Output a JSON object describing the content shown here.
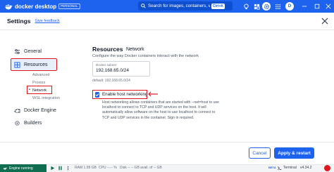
{
  "app": {
    "logo_text": "docker desktop",
    "plan_badge": "PERSONAL",
    "search_placeholder": "Search for images, containers, volu...",
    "search_shortcut": "Ctrl+K",
    "avatar_initial": "D",
    "brand_color": "#1d63ed"
  },
  "header": {
    "title": "Settings",
    "feedback_link": "Give feedback"
  },
  "sidebar": {
    "items": [
      {
        "label": "General",
        "icon": "sliders-icon"
      },
      {
        "label": "Resources",
        "icon": "resources-icon",
        "selected": true
      },
      {
        "label": "Docker Engine",
        "icon": "engine-icon"
      },
      {
        "label": "Builders",
        "icon": "builders-icon"
      }
    ],
    "subitems": [
      {
        "label": "Advanced"
      },
      {
        "label": "Proxies"
      },
      {
        "label": "Network",
        "active": true
      },
      {
        "label": "WSL integration"
      }
    ]
  },
  "main": {
    "section_title": "Resources",
    "section_subtitle": "Network",
    "description": "Configure the way Docker containers interact with the network",
    "subnet_label": "Docker subnet",
    "subnet_value": "192.168.65.0/24",
    "default_text": "default: 192.168.65.0/24",
    "host_networking_label": "Enable host networking",
    "host_networking_checked": true,
    "host_networking_desc": "Host networking allows containers that are started with --net=host to use localhost to connect to TCP and UDP services on the host. It will automatically allow software on the host to use localhost to connect to TCP and UDP services in the container. Sign in required."
  },
  "footer": {
    "cancel_label": "Cancel",
    "apply_label": "Apply & restart"
  },
  "statusbar": {
    "engine_status": "Engine running",
    "ram": "RAM 1.98 GB",
    "cpu": "CPU --.-- %",
    "disk": "Disk -- -- GB avail. of -- GB",
    "beta": "BETA",
    "terminal": "Terminal",
    "version": "v4.34.2"
  }
}
